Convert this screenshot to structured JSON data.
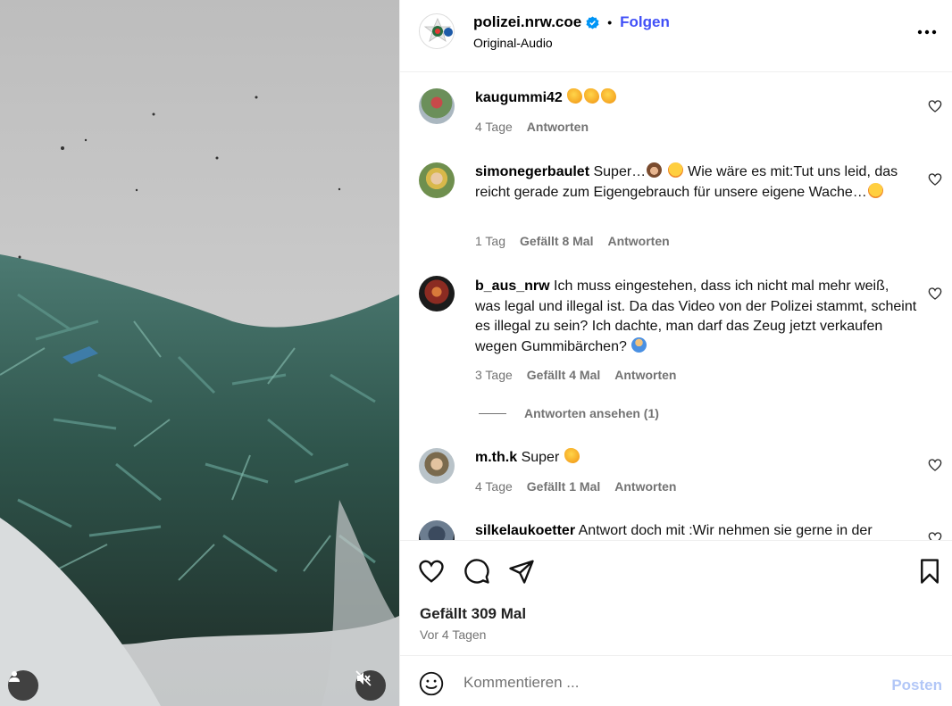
{
  "post": {
    "owner": "polizei.nrw.coe",
    "separator": "•",
    "follow_label": "Folgen",
    "audio": "Original-Audio",
    "likes_text": "Gefällt 309 Mal",
    "time": "Vor 4 Tagen"
  },
  "comments": [
    {
      "user": "kaugummi42",
      "text": "",
      "emojis": [
        "clap",
        "clap",
        "clap"
      ],
      "time": "4 Tage",
      "likes": "",
      "reply": "Antworten"
    },
    {
      "user": "simonegerbaulet",
      "text_parts": [
        "Super…",
        " Wie wäre es mit:Tut uns leid, das reicht gerade zum Eigengebrauch für unsere eigene Wache…"
      ],
      "time": "1 Tag",
      "likes": "Gefällt 8 Mal",
      "reply": "Antworten"
    },
    {
      "user": "b_aus_nrw",
      "text": "Ich muss eingestehen, dass ich nicht mal mehr weiß, was legal und illegal ist. Da das Video von der Polizei stammt, scheint es illegal zu sein? Ich dachte, man darf das Zeug jetzt verkaufen wegen Gummibärchen?",
      "time": "3 Tage",
      "likes": "Gefällt 4 Mal",
      "reply": "Antworten",
      "view_replies": "Antworten ansehen (1)"
    },
    {
      "user": "m.th.k",
      "text": "Super",
      "time": "4 Tage",
      "likes": "Gefällt 1 Mal",
      "reply": "Antworten"
    },
    {
      "user": "silkelaukoetter",
      "text": "Antwort doch mit :Wir nehmen sie gerne in der"
    }
  ],
  "composer": {
    "placeholder": "Kommentieren ...",
    "post_label": "Posten"
  },
  "colors": {
    "accent": "#4150f7",
    "muted": "#737373",
    "post_disabled": "#b2c7f7",
    "verified": "#0095f6"
  },
  "icons": {
    "more": "more-horizontal-icon",
    "like": "heart-outline-icon",
    "comment": "comment-bubble-icon",
    "share": "paper-plane-icon",
    "save": "bookmark-icon",
    "emoji": "smiley-icon",
    "profile": "user-icon",
    "mute": "speaker-muted-icon"
  }
}
